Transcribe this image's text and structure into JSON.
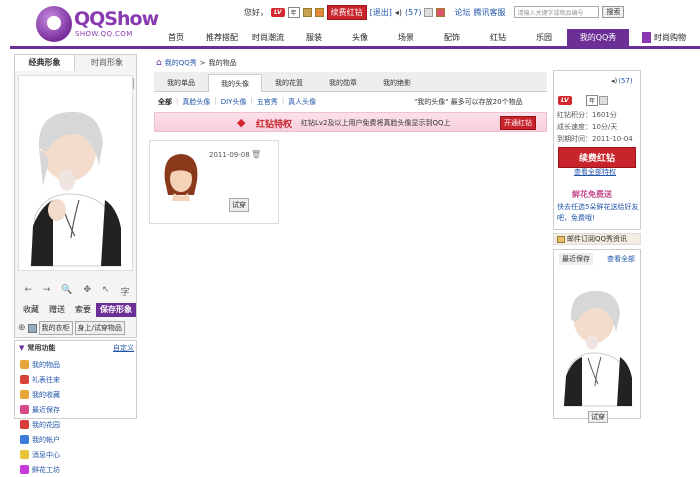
{
  "logo": {
    "text": "QQShow",
    "sub": "SHOW.QQ.COM"
  },
  "topbar": {
    "greeting": "您好，",
    "vip_year": "年",
    "renew": "续费红钻",
    "logout": "[退出]",
    "msg_count": "(57)",
    "forum": "论坛",
    "service": "腾讯客服",
    "search_placeholder": "请输入关键字或物品编号",
    "search_btn": "搜索"
  },
  "nav": [
    "首页",
    "推荐搭配",
    "时尚潮流",
    "服装",
    "头像",
    "场景",
    "配饰",
    "红钻",
    "乐园",
    "我的QQ秀",
    "时尚购物"
  ],
  "left": {
    "tab1": "经典形象",
    "tab2": "时尚形象",
    "male": "男",
    "female": "女",
    "tools": [
      "←",
      "→",
      "🔍",
      "✥",
      "↖",
      "字"
    ],
    "actions": {
      "collect": "收藏",
      "gift": "赠送",
      "ask": "索要",
      "save": "保存形象"
    },
    "wardrobe": "我的衣柜",
    "tryon": "身上/试穿物品"
  },
  "side": {
    "title": "常用功能",
    "custom": "自定义",
    "items": [
      "我的物品",
      "礼表往来",
      "我的收藏",
      "最近保存",
      "我的花园",
      "我的帐户",
      "消息中心",
      "鲜花工坊"
    ],
    "colors": [
      "#e8a53a",
      "#d8443a",
      "#e8a53a",
      "#d84a8a",
      "#d83a3a",
      "#3a7ad8",
      "#e8c33a",
      "#c53ad8"
    ]
  },
  "crumb": {
    "my": "我的QQ秀",
    "cur": "我的物品"
  },
  "subtabs": [
    "我的单品",
    "我的头像",
    "我的花篮",
    "我的勋章",
    "我的绝影"
  ],
  "filters": [
    "全部",
    "真脸头像",
    "DIY头像",
    "五官秀",
    "真人头像"
  ],
  "capnote": "\"我的头像\" 最多可以存放20个物品",
  "vip": {
    "title": "红钻特权",
    "desc": "红钻Lv2及以上用户免费将真脸头像显示到QQ上",
    "btn": "开通红钻"
  },
  "item": {
    "date": "2011-09-08",
    "tryon": "试穿"
  },
  "right": {
    "msg": "(57)",
    "points": "红钻积分：1601分",
    "speed": "成长速度：10分/天",
    "expire": "到期时间：2011-10-04",
    "renew": "续费红钻",
    "view_all": "查看全部特权",
    "flower_title": "鲜花免费送",
    "flower_desc": "快去任选5朵鲜花送给好友吧，免费哦!",
    "subscribe": "邮件订阅QQ秀资讯",
    "recent": "最近保存",
    "view": "查看全部",
    "tryon": "试穿"
  }
}
